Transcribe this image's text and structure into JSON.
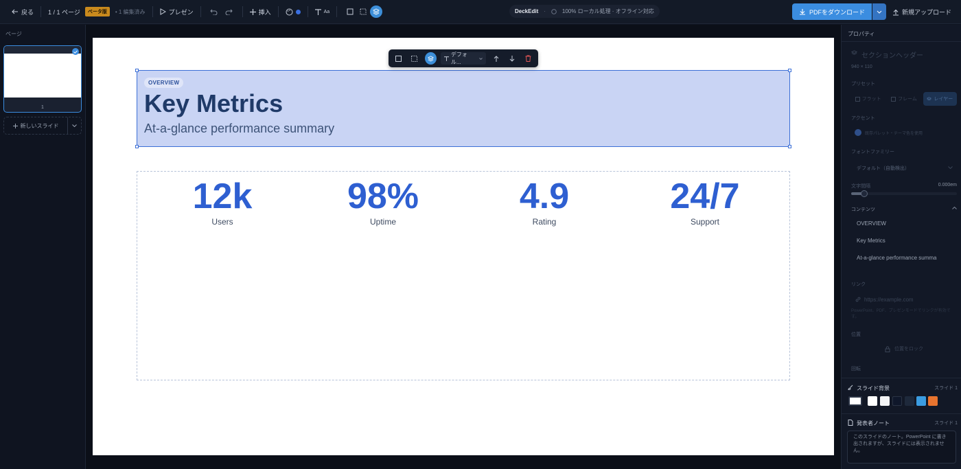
{
  "topbar": {
    "back_label": "戻る",
    "page_count": "1 / 1 ページ",
    "beta_badge": "ベータ版",
    "edit_status": "• 1 編集済み",
    "present_label": "プレゼン",
    "insert_label": "挿入",
    "text_style_label": "Aa",
    "app_name": "DeckEdit",
    "offline_status": "100% ローカル処理 · オフライン対応",
    "download_pdf_label": "PDFをダウンロード",
    "new_upload_label": "新規アップロード"
  },
  "left_panel": {
    "title": "ページ",
    "thumbnail_number": "1",
    "new_slide_label": "新しいスライド"
  },
  "floating_toolbar": {
    "font_label": "デフォル..."
  },
  "slide": {
    "background": "#ffffff",
    "eyebrow": "OVERVIEW",
    "title": "Key Metrics",
    "subtitle": "At-a-glance performance summary",
    "stats": [
      {
        "value": "12k",
        "label": "Users"
      },
      {
        "value": "98%",
        "label": "Uptime"
      },
      {
        "value": "4.9",
        "label": "Rating"
      },
      {
        "value": "24/7",
        "label": "Support"
      }
    ]
  },
  "right_panel": {
    "title": "プロパティ",
    "section_name": "セクションヘッダー",
    "size_text": "940 × 110",
    "preset_label": "プリセット",
    "presets": [
      "フラット",
      "フレーム",
      "レイヤー"
    ],
    "accent_label": "アクセント",
    "accent_text": "既存パレット・テーマ色を使用",
    "font_family_label": "フォントファミリー",
    "font_family_value": "デフォルト（自動検出）",
    "letter_spacing_label": "文字間隔",
    "letter_spacing_value": "0.000em",
    "content_label": "コンテンツ",
    "content_fields": [
      "OVERVIEW",
      "Key Metrics",
      "At-a-glance performance summa"
    ],
    "link_label": "リンク",
    "link_placeholder": "https://example.com",
    "link_hint": "PowerPoint、PDF、プレゼンモードでリンクが有効です。",
    "position_label": "位置",
    "lock_position_label": "位置をロック",
    "rotation_label": "回転",
    "slide_bg_label": "スライド背景",
    "slide_bg_scope": "スライド 1",
    "bg_colors": [
      "#ffffff",
      "#f3f4f6",
      "#0f172a",
      "#1e293b",
      "#3b9ce0",
      "#e8742f"
    ],
    "notes_label": "発表者ノート",
    "notes_scope": "スライド 1",
    "notes_placeholder": "このスライドのノート。PowerPoint に書き出されますが、スライドには表示されません。"
  },
  "colors": {
    "accent": "#3b8de0",
    "title_color": "#1f3a68",
    "stat_color": "#2e5fd1",
    "selection_fill": "#c9d4f4",
    "selection_border": "#3b6fd6"
  }
}
